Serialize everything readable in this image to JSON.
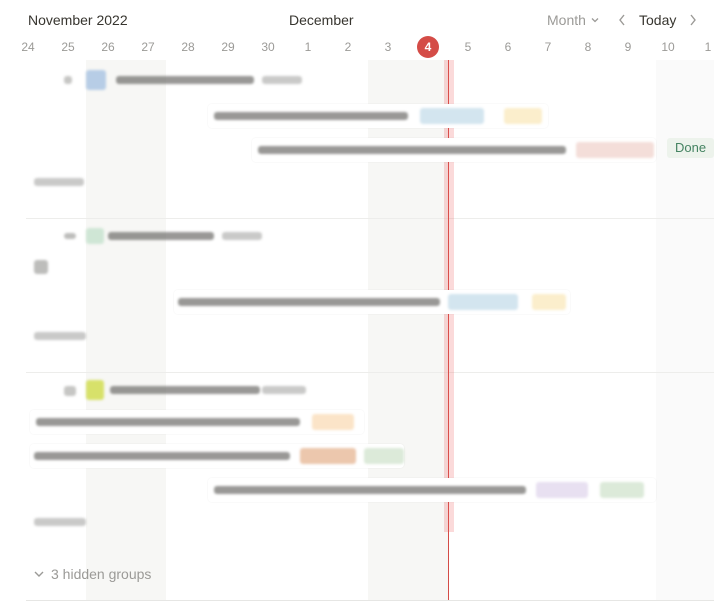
{
  "header": {
    "month_left": "November 2022",
    "month_right": "December",
    "view_label": "Month",
    "today_label": "Today"
  },
  "days": [
    "24",
    "25",
    "26",
    "27",
    "28",
    "29",
    "30",
    "1",
    "2",
    "3",
    "4",
    "5",
    "6",
    "7",
    "8",
    "9",
    "10",
    "1"
  ],
  "today_index": 10,
  "colors": {
    "accent": "#d44c47",
    "done_text": "#448361",
    "done_bg": "#edf3ec"
  },
  "timeline": {
    "done_tag": "Done",
    "hidden_groups_label": "3 hidden groups"
  }
}
